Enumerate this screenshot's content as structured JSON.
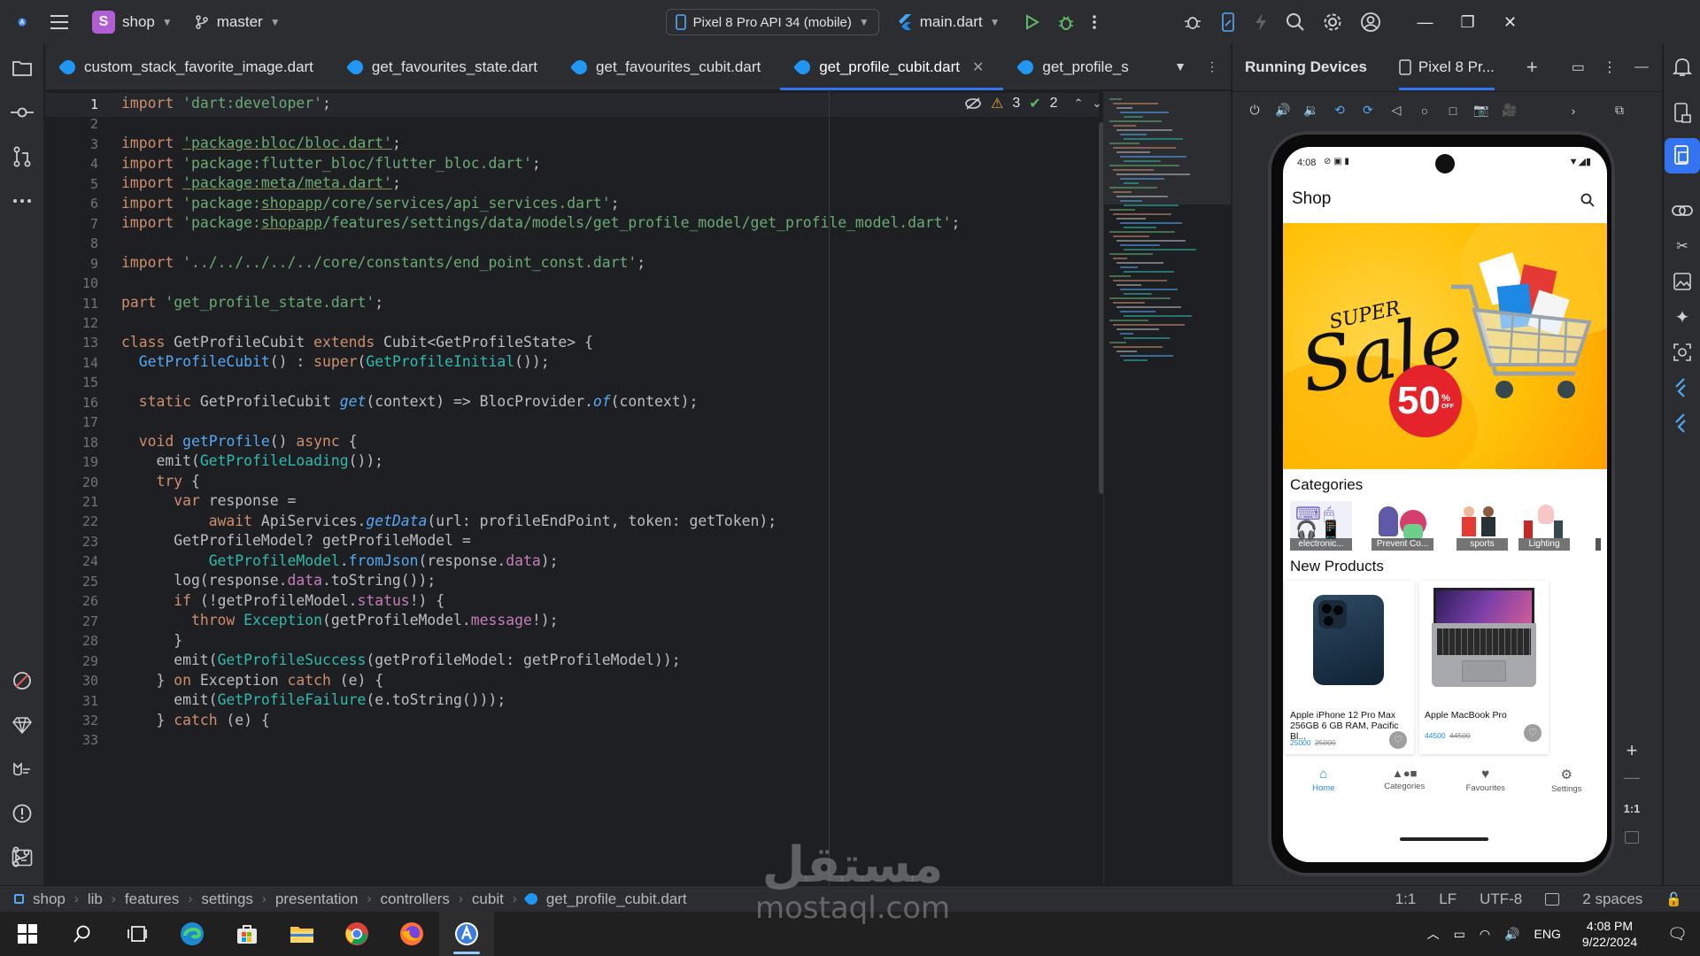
{
  "titlebar": {
    "project_initial": "S",
    "project_name": "shop",
    "branch": "master",
    "device": "Pixel 8 Pro API 34 (mobile)",
    "run_config": "main.dart"
  },
  "tabs": [
    {
      "label": "custom_stack_favorite_image.dart",
      "active": false
    },
    {
      "label": "get_favourites_state.dart",
      "active": false
    },
    {
      "label": "get_favourites_cubit.dart",
      "active": false
    },
    {
      "label": "get_profile_cubit.dart",
      "active": true
    },
    {
      "label": "get_profile_s",
      "active": false
    }
  ],
  "inspections": {
    "warnings": "3",
    "weak_warnings": "2"
  },
  "editor": {
    "line_numbers": [
      "1",
      "2",
      "3",
      "4",
      "5",
      "6",
      "7",
      "8",
      "9",
      "10",
      "11",
      "12",
      "13",
      "14",
      "15",
      "16",
      "17",
      "18",
      "19",
      "20",
      "21",
      "22",
      "23",
      "24",
      "25",
      "26",
      "27",
      "28",
      "29",
      "30",
      "31",
      "32",
      "33"
    ],
    "current_line": 1
  },
  "running_devices": {
    "title": "Running Devices",
    "device_tab": "Pixel 8 Pr..."
  },
  "phone": {
    "status_time": "4:08",
    "app_title": "Shop",
    "banner": {
      "super": "SUPER",
      "sale": "Sale",
      "percent": "50",
      "pct_sign": "%",
      "off": "OFF"
    },
    "categories_title": "Categories",
    "categories": [
      "electronic...",
      "Prevent Co...",
      "sports",
      "Lighting"
    ],
    "new_products_title": "New Products",
    "products": [
      {
        "name": "Apple iPhone 12 Pro Max 256GB 6 GB RAM, Pacific Bl...",
        "price": "25000",
        "old_price": "25000"
      },
      {
        "name": "Apple MacBook Pro",
        "price": "44500",
        "old_price": "44500"
      }
    ],
    "nav": [
      "Home",
      "Categories",
      "Favourites",
      "Settings"
    ],
    "side_zoom_label": "1:1"
  },
  "statusbar": {
    "breadcrumb": [
      "shop",
      "lib",
      "features",
      "settings",
      "presentation",
      "controllers",
      "cubit",
      "get_profile_cubit.dart"
    ],
    "position": "1:1",
    "line_sep": "LF",
    "encoding": "UTF-8",
    "indent": "2 spaces"
  },
  "taskbar": {
    "language": "ENG",
    "time": "4:08 PM",
    "date": "9/22/2024"
  },
  "watermark": {
    "arabic": "مستقل",
    "latin": "mostaql.com"
  },
  "colors": {
    "accent": "#3574f0",
    "keyword": "#cf8e6d",
    "string": "#6aab73",
    "function": "#56a8f5",
    "class": "#2fbaad",
    "banner": "#ffc107"
  }
}
